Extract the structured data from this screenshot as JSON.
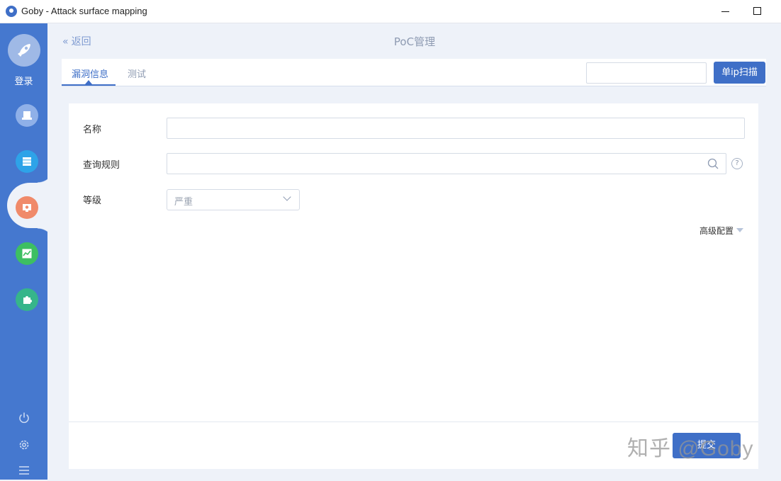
{
  "window": {
    "title": "Goby - Attack surface mapping",
    "min_icon": "minimize-icon",
    "max_icon": "maximize-icon"
  },
  "sidebar": {
    "login_label": "登录",
    "avatar_icon": "rocket-icon",
    "nav": [
      {
        "icon": "scan-icon",
        "color": "#8fb0e8"
      },
      {
        "icon": "assets-icon",
        "color": "#2ea3e8"
      },
      {
        "icon": "vulnerability-icon",
        "color": "#f08a6a",
        "active": true
      },
      {
        "icon": "report-icon",
        "color": "#3dbf62"
      },
      {
        "icon": "plugin-icon",
        "color": "#36b58a"
      }
    ],
    "bottom": [
      {
        "icon": "power-icon"
      },
      {
        "icon": "gear-icon"
      },
      {
        "icon": "menu-icon"
      }
    ]
  },
  "header": {
    "back_label": "返回",
    "page_title": "PoC管理"
  },
  "tabs": [
    {
      "label": "漏洞信息",
      "active": true
    },
    {
      "label": "测试",
      "active": false
    }
  ],
  "scan": {
    "ip_input_value": "",
    "button_label": "单ip扫描"
  },
  "form": {
    "name_label": "名称",
    "name_value": "",
    "rule_label": "查询规则",
    "rule_value": "",
    "level_label": "等级",
    "level_value": "严重",
    "advanced_label": "高级配置",
    "submit_label": "提交"
  },
  "watermark": "知乎 @Goby",
  "colors": {
    "primary": "#3f6fc7",
    "sidebar": "#4578cf",
    "background": "#eef2f9"
  }
}
